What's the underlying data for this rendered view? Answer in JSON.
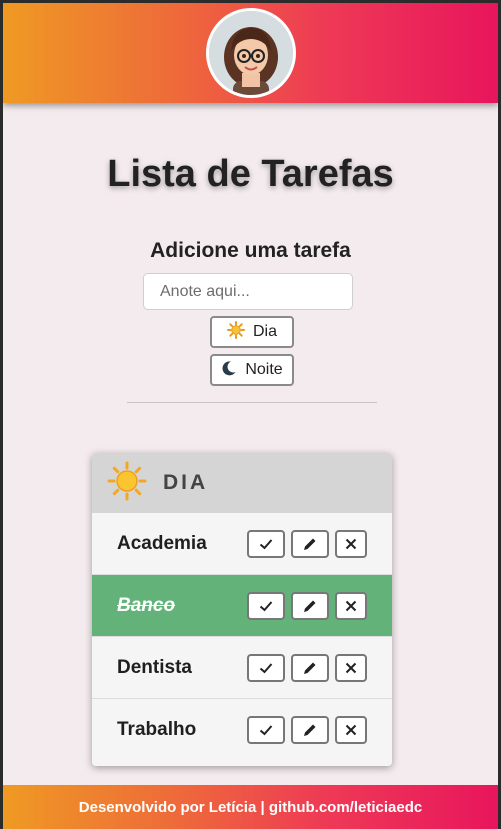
{
  "header": {
    "avatar_alt": "Avatar de Letícia"
  },
  "main": {
    "title": "Lista de Tarefas",
    "subtitle": "Adicione uma tarefa",
    "input_placeholder": "Anote aqui...",
    "day_button": "Dia",
    "night_button": "Noite"
  },
  "card": {
    "title": "DIA",
    "tasks": [
      {
        "label": "Academia",
        "done": false
      },
      {
        "label": "Banco",
        "done": true
      },
      {
        "label": "Dentista",
        "done": false
      },
      {
        "label": "Trabalho",
        "done": false
      }
    ]
  },
  "footer": {
    "text": "Desenvolvido por Letícia | github.com/leticiaedc"
  },
  "colors": {
    "gradient_start": "#ef9a23",
    "gradient_end": "#e8155d",
    "done_row": "#62b27a",
    "background": "#f4ebee"
  },
  "icons": [
    "avatar",
    "sun-icon",
    "moon-icon",
    "check-icon",
    "pencil-icon",
    "close-icon"
  ]
}
